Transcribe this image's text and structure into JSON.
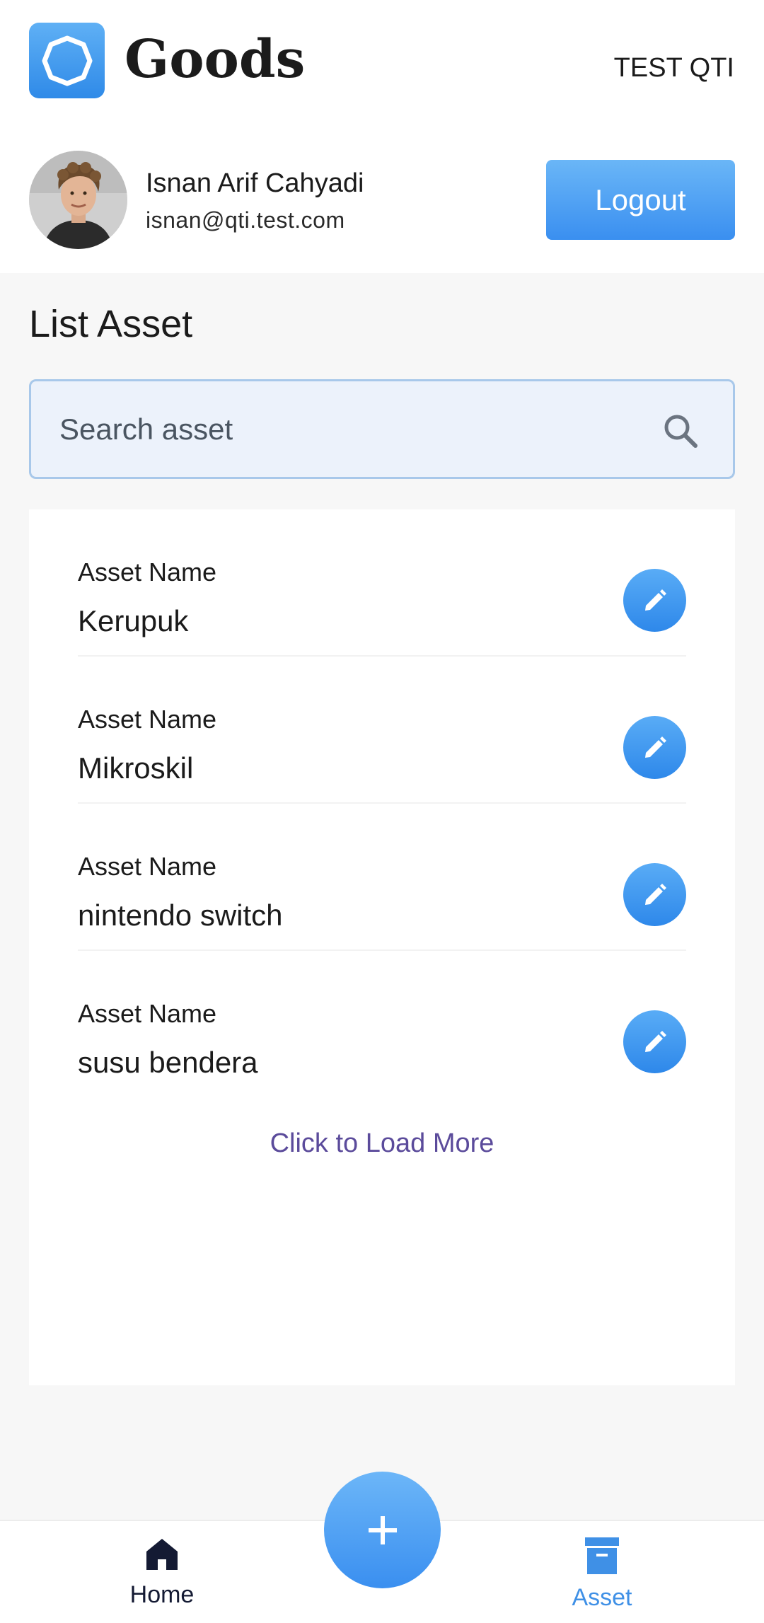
{
  "header": {
    "app_title": "Goods",
    "org_name": "TEST QTI",
    "logo_icon": "octagon-ring-icon"
  },
  "profile": {
    "name": "Isnan Arif Cahyadi",
    "email": "isnan@qti.test.com",
    "logout_label": "Logout"
  },
  "main": {
    "section_title": "List Asset",
    "search": {
      "placeholder": "Search asset",
      "value": "",
      "icon": "search-icon"
    },
    "assets": [
      {
        "label": "Asset Name",
        "value": "Kerupuk"
      },
      {
        "label": "Asset Name",
        "value": "Mikroskil"
      },
      {
        "label": "Asset Name",
        "value": "nintendo switch"
      },
      {
        "label": "Asset Name",
        "value": "susu bendera"
      }
    ],
    "load_more_label": "Click to Load More"
  },
  "bottom_nav": {
    "items": [
      {
        "label": "Home",
        "icon": "home-icon",
        "active": false
      },
      {
        "label": "Asset",
        "icon": "archive-box-icon",
        "active": true
      }
    ],
    "fab_icon": "plus-icon"
  },
  "colors": {
    "accent": "#3a8ff0",
    "accent_light": "#6ab6f7",
    "content_bg": "#f7f7f7",
    "search_bg": "#ecf2fb",
    "search_border": "#a8c8ea",
    "load_more": "#5b4b9b",
    "nav_active": "#3f90e6",
    "nav_inactive": "#141a33"
  }
}
